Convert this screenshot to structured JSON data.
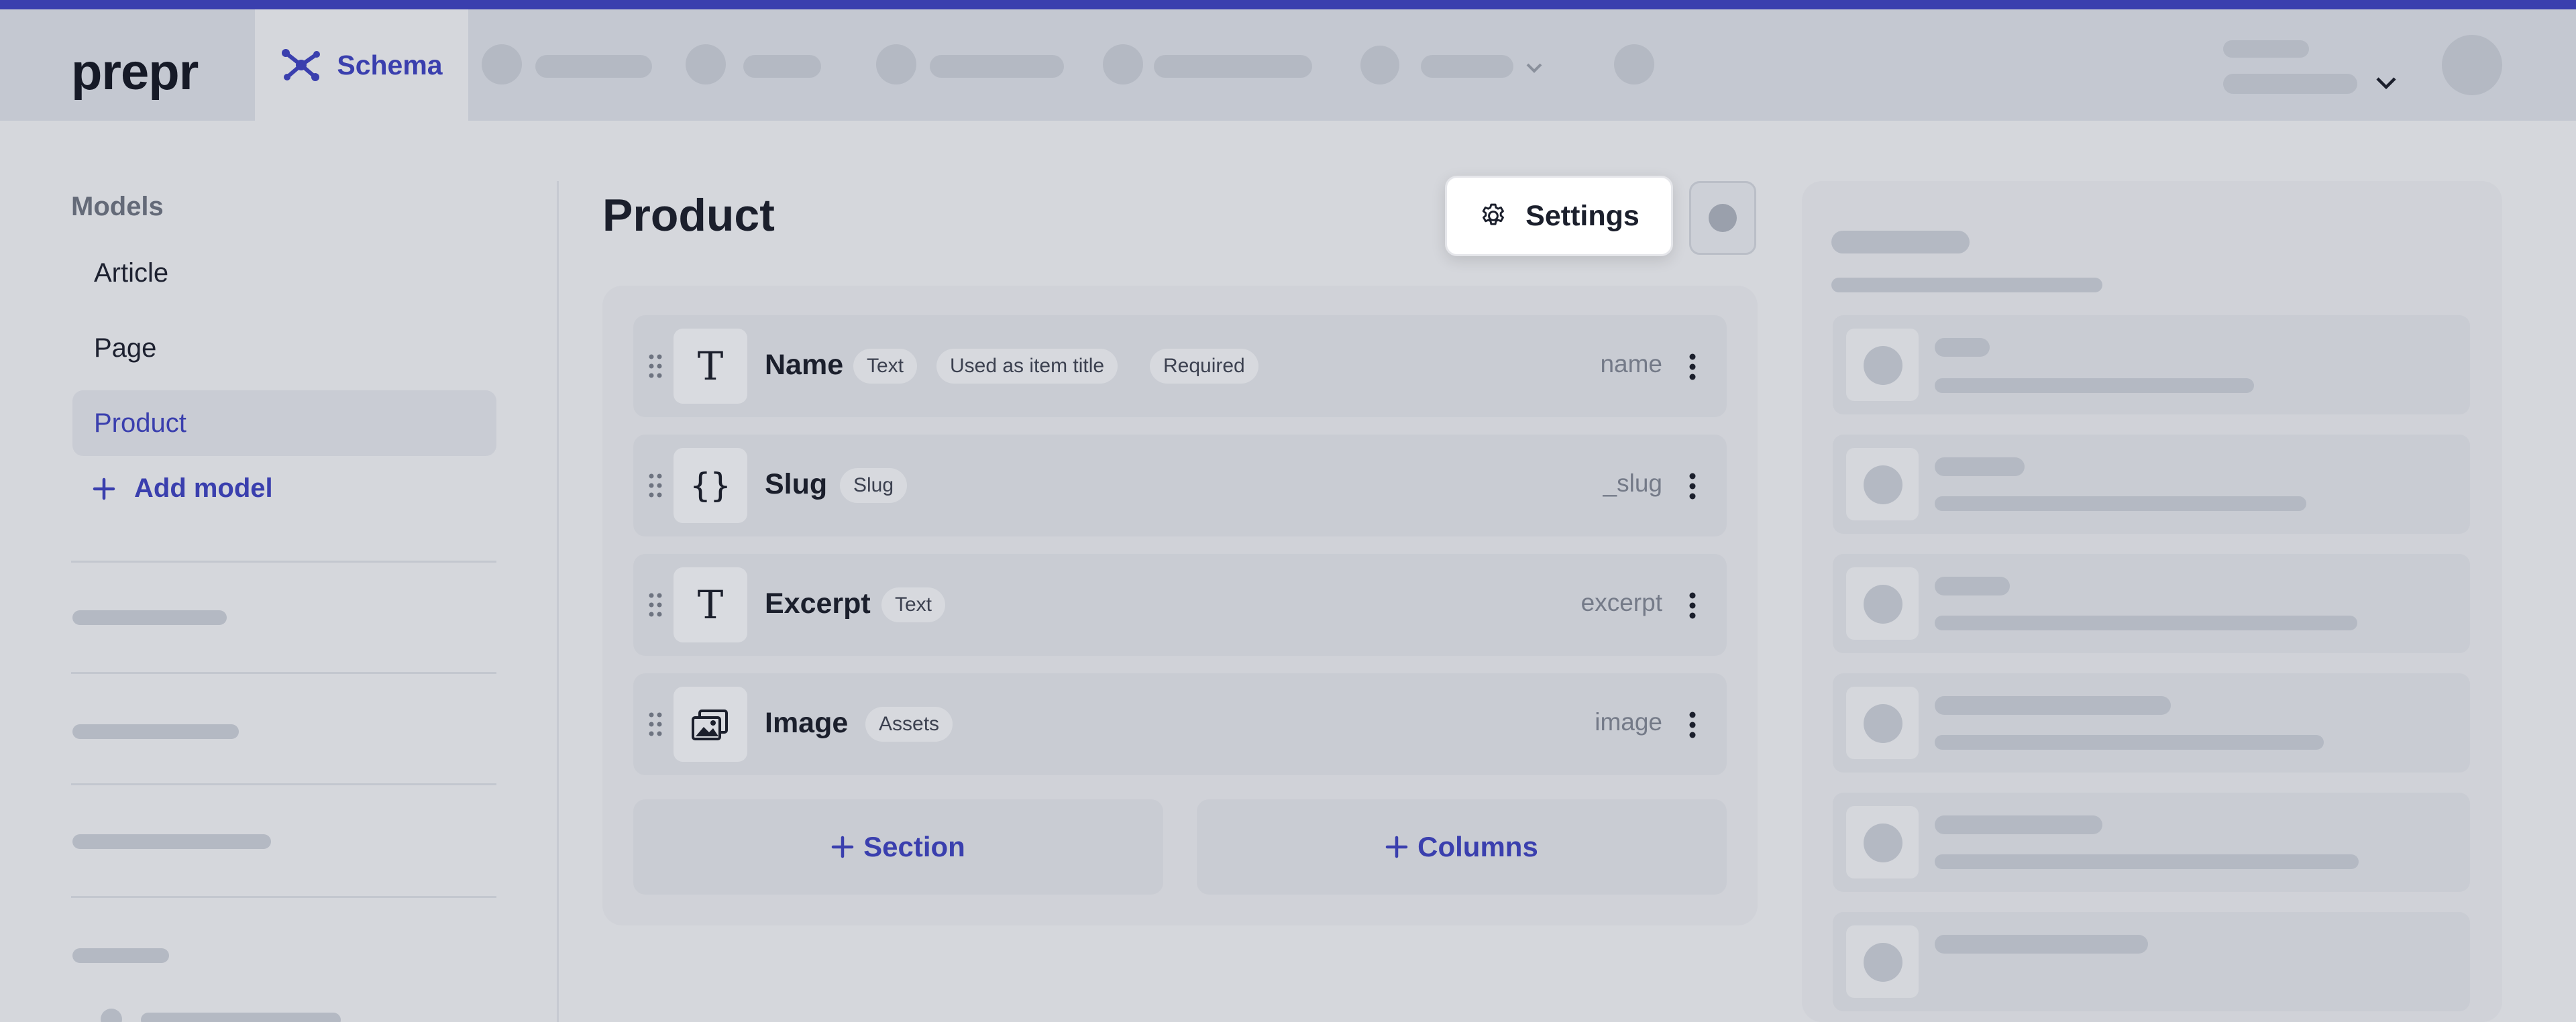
{
  "header": {
    "logo_text": "prepr",
    "active_tab_label": "Schema"
  },
  "sidebar": {
    "title": "Models",
    "items": [
      {
        "label": "Article",
        "active": false
      },
      {
        "label": "Page",
        "active": false
      },
      {
        "label": "Product",
        "active": true
      }
    ],
    "add_model_label": "Add model"
  },
  "main": {
    "title": "Product",
    "settings_label": "Settings",
    "fields": [
      {
        "name": "Name",
        "icon": "text-icon",
        "tags": [
          "Text",
          "Used as item title",
          "Required"
        ],
        "api_id": "name"
      },
      {
        "name": "Slug",
        "icon": "braces-icon",
        "tags": [
          "Slug"
        ],
        "api_id": "_slug"
      },
      {
        "name": "Excerpt",
        "icon": "text-icon",
        "tags": [
          "Text"
        ],
        "api_id": "excerpt"
      },
      {
        "name": "Image",
        "icon": "image-icon",
        "tags": [
          "Assets"
        ],
        "api_id": "image"
      }
    ],
    "add_section_label": "Section",
    "add_columns_label": "Columns"
  },
  "colors": {
    "accent": "#3a3fae",
    "background": "#d5d7dc",
    "header": "#c4c8d1",
    "placeholder": "#b4b9c3"
  }
}
